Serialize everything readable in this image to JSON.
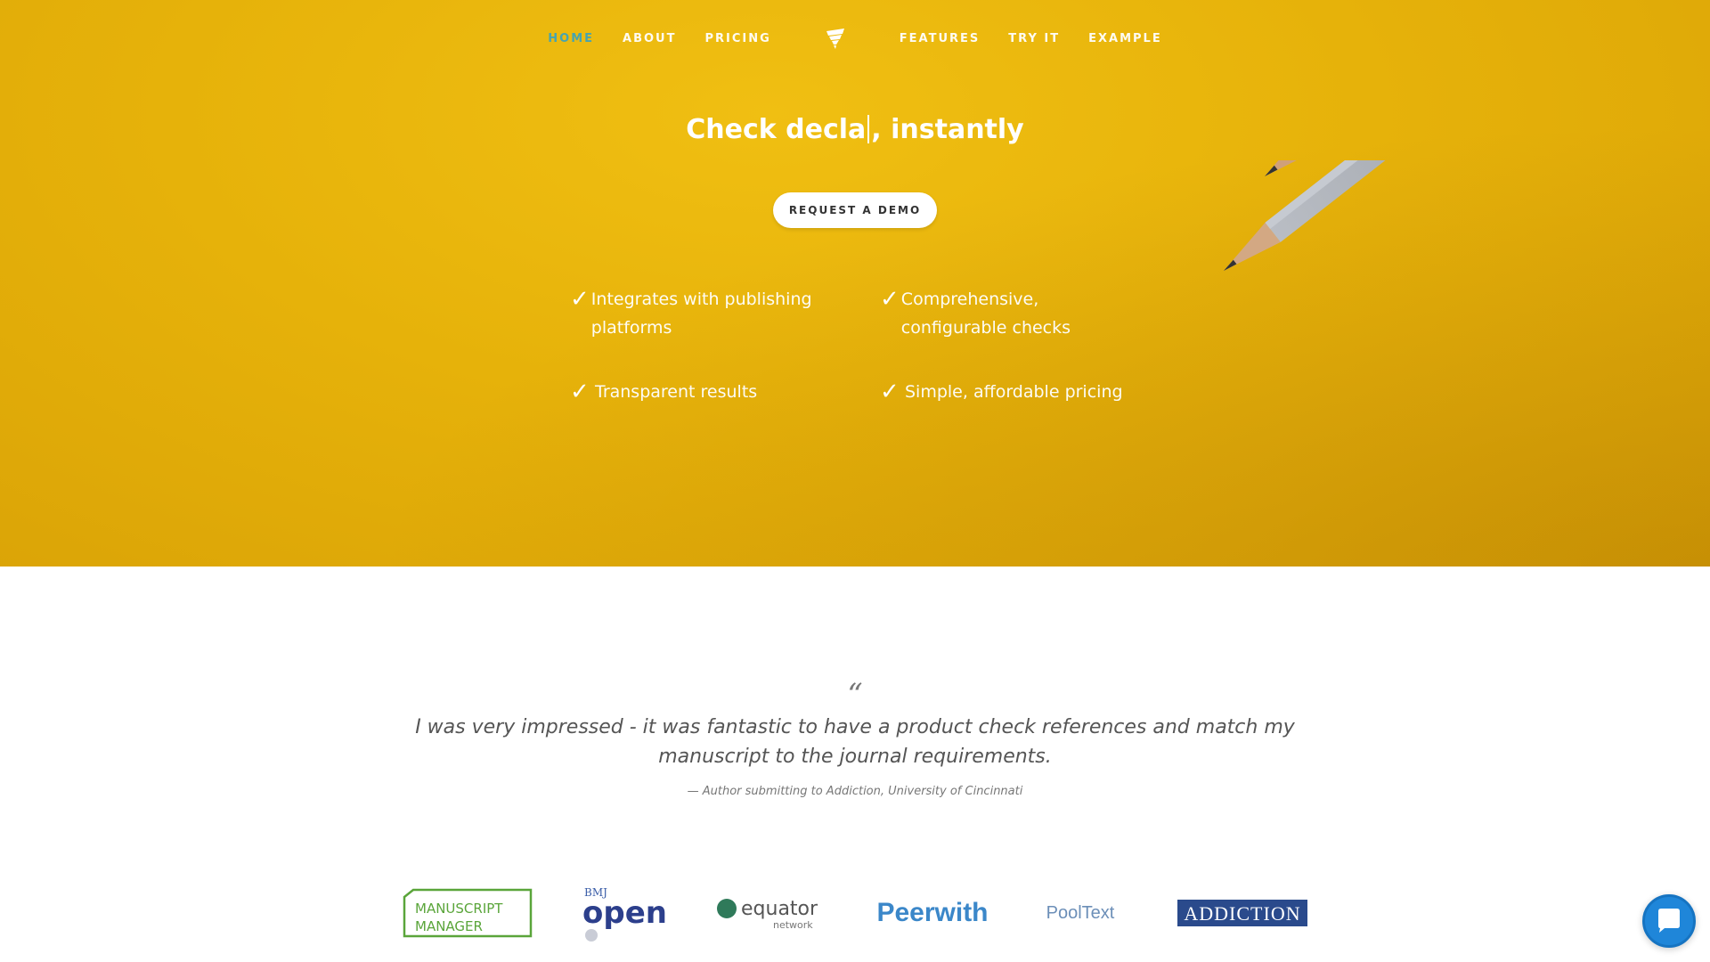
{
  "nav": {
    "left": [
      "HOME",
      "ABOUT",
      "PRICING"
    ],
    "right": [
      "FEATURES",
      "TRY IT",
      "EXAMPLE"
    ],
    "active": "HOME",
    "logo_icon": "feather-shield-icon",
    "active_color": "#3fa3b8"
  },
  "hero": {
    "headline_prefix": "Check ",
    "headline_typed": "decla",
    "headline_suffix": ", instantly",
    "cta": "REQUEST A DEMO",
    "background_color": "#e6b20a",
    "features": [
      "Integrates with publishing platforms",
      "Comprehensive, configurable checks",
      "Transparent results",
      "Simple, affordable pricing"
    ]
  },
  "testimonial": {
    "mark": "“",
    "quote": "I was very impressed - it was fantastic to have a product check references and match my manuscript to the journal requirements.",
    "attribution": "— Author submitting to Addiction, University of Cincinnati"
  },
  "partners": {
    "manuscript_manager": [
      "MANUSCRIPT",
      "MANAGER"
    ],
    "bmj_small": "BMJ",
    "bmj_big": "open",
    "equator": "equator",
    "equator_sub": "network",
    "peerwith": "Peerwith",
    "pooltext": "PoolText",
    "addiction": "ADDICTION"
  },
  "chat": {
    "icon": "chat-bubble-icon",
    "color": "#1f86d9"
  }
}
